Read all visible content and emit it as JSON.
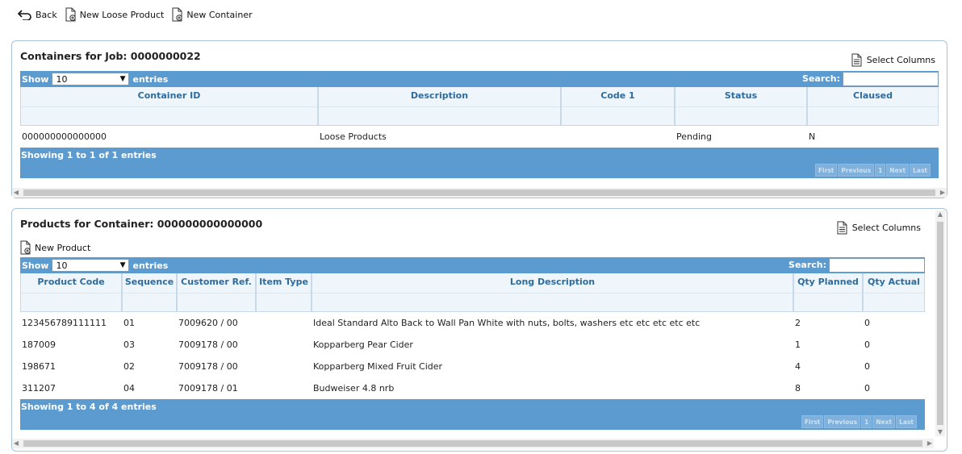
{
  "toolbar": {
    "back_label": "Back",
    "new_loose_product_label": "New Loose Product",
    "new_container_label": "New Container"
  },
  "containers": {
    "title": "Containers for Job: 0000000022",
    "select_columns_label": "Select Columns",
    "show_label": "Show",
    "entries_per_page": "10",
    "entries_label": "entries",
    "search_label": "Search:",
    "search_value": "",
    "columns": [
      "Container ID",
      "Description",
      "Code 1",
      "Status",
      "Claused"
    ],
    "rows": [
      [
        "000000000000000",
        "Loose Products",
        "",
        "Pending",
        "N"
      ]
    ],
    "info": "Showing 1 to 1 of 1 entries",
    "pager": [
      "First",
      "Previous",
      "1",
      "Next",
      "Last"
    ]
  },
  "products": {
    "title": "Products for Container: 000000000000000",
    "select_columns_label": "Select Columns",
    "new_product_label": "New Product",
    "show_label": "Show",
    "entries_per_page": "10",
    "entries_label": "entries",
    "search_label": "Search:",
    "search_value": "",
    "columns": [
      "Product Code",
      "Sequence",
      "Customer Ref.",
      "Item Type",
      "Long Description",
      "Qty Planned",
      "Qty Actual"
    ],
    "rows": [
      [
        "123456789111111",
        "01",
        "7009620 / 00",
        "",
        "Ideal Standard Alto Back to Wall Pan White with nuts, bolts, washers etc etc etc etc etc",
        "2",
        "0"
      ],
      [
        "187009",
        "03",
        "7009178 / 00",
        "",
        "Kopparberg Pear Cider",
        "1",
        "0"
      ],
      [
        "198671",
        "02",
        "7009178 / 00",
        "",
        "Kopparberg Mixed Fruit Cider",
        "4",
        "0"
      ],
      [
        "311207",
        "04",
        "7009178 / 01",
        "",
        "Budweiser 4.8 nrb",
        "8",
        "0"
      ]
    ],
    "info": "Showing 1 to 4 of 4 entries",
    "pager": [
      "First",
      "Previous",
      "1",
      "Next",
      "Last"
    ]
  },
  "icons": {
    "back": "undo-arrow-icon",
    "new_doc": "new-document-icon",
    "select_columns": "document-icon"
  }
}
